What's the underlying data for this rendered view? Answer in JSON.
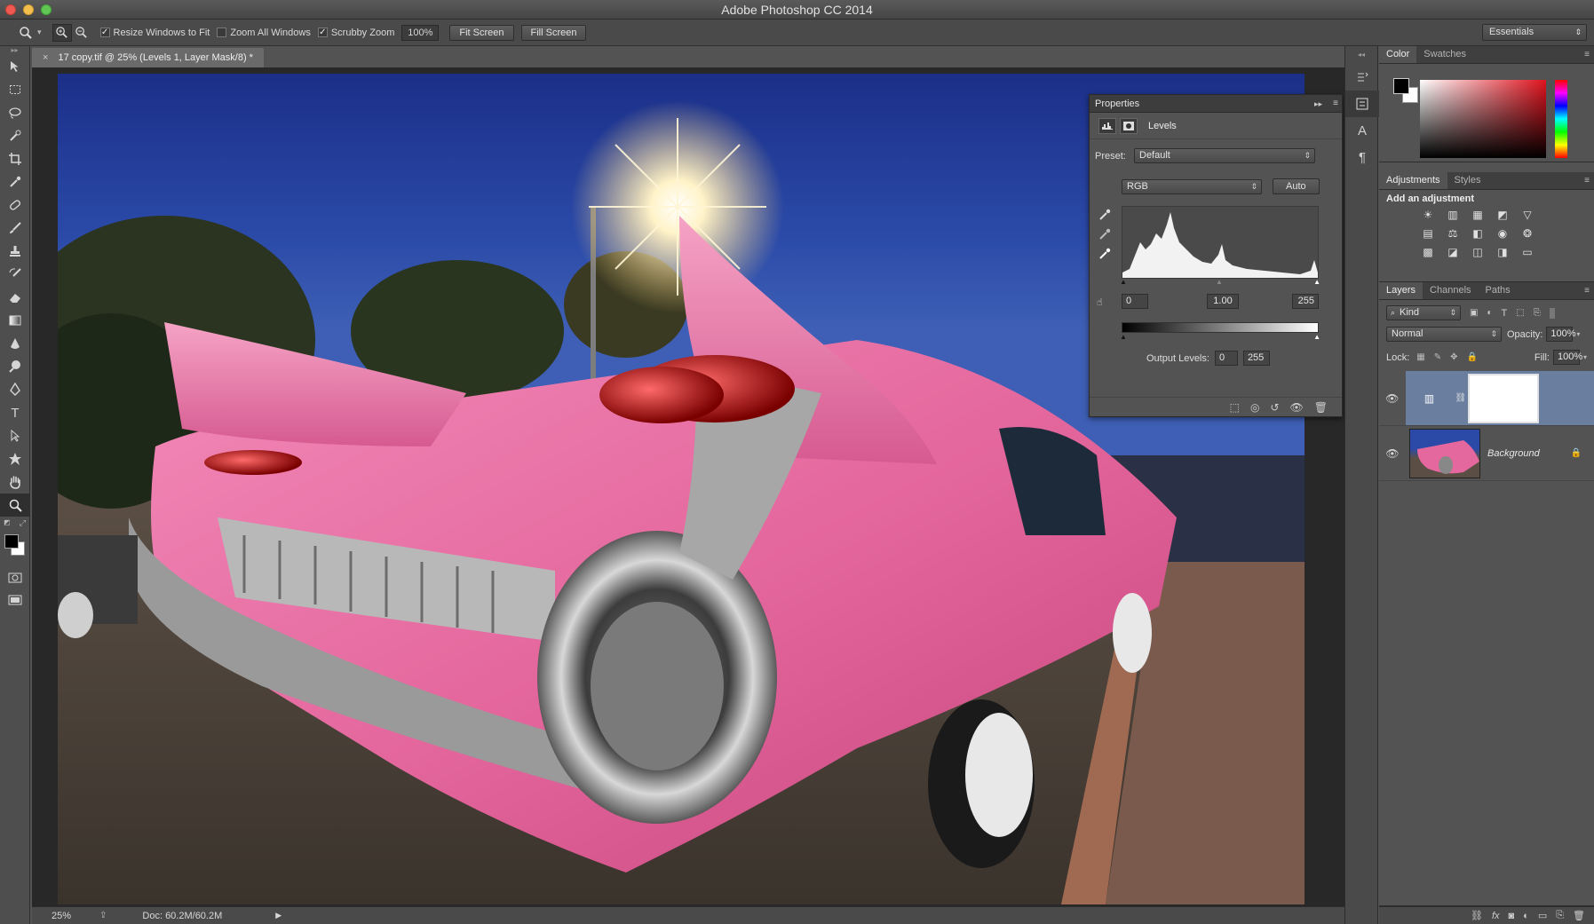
{
  "app_title": "Adobe Photoshop CC 2014",
  "options_bar": {
    "tool_icon": "zoom-icon",
    "resize_windows": {
      "label": "Resize Windows to Fit",
      "checked": true
    },
    "zoom_all": {
      "label": "Zoom All Windows",
      "checked": false
    },
    "scrubby_zoom": {
      "label": "Scrubby Zoom",
      "checked": true
    },
    "zoom_value": "100%",
    "fit_screen": "Fit Screen",
    "fill_screen": "Fill Screen",
    "workspace": "Essentials"
  },
  "document": {
    "tab_close": "×",
    "tab_title": "17 copy.tif @ 25% (Levels 1, Layer Mask/8) *"
  },
  "status": {
    "zoom": "25%",
    "doc_size": "Doc: 60.2M/60.2M"
  },
  "properties": {
    "header": "Properties",
    "title": "Levels",
    "preset_label": "Preset:",
    "preset_value": "Default",
    "channel": "RGB",
    "auto_label": "Auto",
    "input_black": "0",
    "input_gamma": "1.00",
    "input_white": "255",
    "output_label": "Output Levels:",
    "output_black": "0",
    "output_white": "255"
  },
  "color_panel": {
    "tabs": [
      "Color",
      "Swatches"
    ],
    "active_tab": "Color",
    "foreground": "#000000",
    "background": "#ffffff"
  },
  "adjustments_panel": {
    "tabs": [
      "Adjustments",
      "Styles"
    ],
    "heading": "Add an adjustment"
  },
  "layers_panel": {
    "tabs": [
      "Layers",
      "Channels",
      "Paths"
    ],
    "filter": "Kind",
    "blend_mode": "Normal",
    "opacity_label": "Opacity:",
    "opacity": "100%",
    "lock_label": "Lock:",
    "fill_label": "Fill:",
    "fill": "100%",
    "layers": [
      {
        "name": "",
        "type": "levels-adjustment",
        "selected": true
      },
      {
        "name": "Background",
        "type": "image",
        "selected": false
      }
    ]
  },
  "colors": {
    "accent_selected_layer": "#6a7ea0",
    "pink_car": "#e86aa0"
  }
}
